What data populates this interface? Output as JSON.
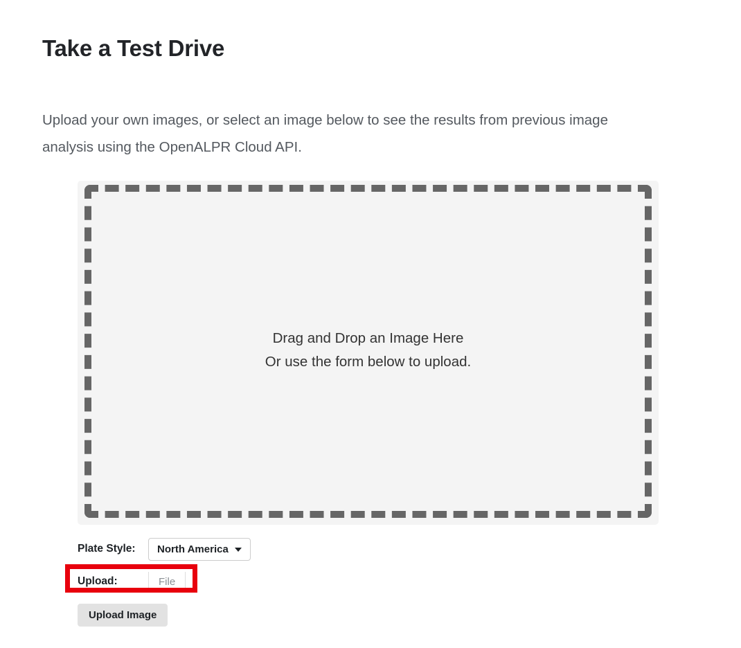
{
  "page": {
    "title": "Take a Test Drive",
    "intro": "Upload your own images, or select an image below to see the results from previous image analysis using the OpenALPR Cloud API."
  },
  "dropzone": {
    "line1": "Drag and Drop an Image Here",
    "line2": "Or use the form below to upload.",
    "panel_background": "#f4f4f4",
    "dash_color": "#666666"
  },
  "form": {
    "plate_style": {
      "label": "Plate Style:",
      "selected": "North America",
      "caret_icon": "caret-down-icon",
      "options": [
        "North America"
      ]
    },
    "upload": {
      "label": "Upload:",
      "file_button_text": "File",
      "highlight_color": "#e8000d"
    },
    "submit": {
      "label": "Upload Image"
    }
  }
}
